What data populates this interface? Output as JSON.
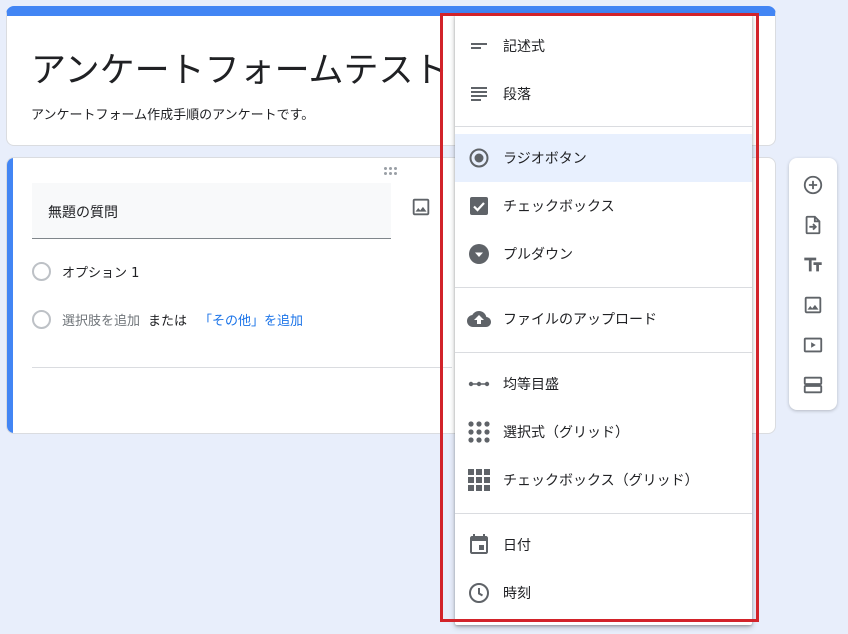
{
  "form": {
    "title": "アンケートフォームテスト",
    "description": "アンケートフォーム作成手順のアンケートです。"
  },
  "question": {
    "title": "無題の質問",
    "option1": "オプション 1",
    "add_option": "選択肢を追加",
    "or_text": "または",
    "add_other": "「その他」を追加"
  },
  "menu": {
    "items": [
      {
        "label": "記述式",
        "icon": "short-text-icon"
      },
      {
        "label": "段落",
        "icon": "paragraph-icon"
      },
      {
        "label": "ラジオボタン",
        "icon": "radio-button-icon"
      },
      {
        "label": "チェックボックス",
        "icon": "checkbox-icon"
      },
      {
        "label": "プルダウン",
        "icon": "dropdown-icon"
      },
      {
        "label": "ファイルのアップロード",
        "icon": "cloud-upload-icon"
      },
      {
        "label": "均等目盛",
        "icon": "linear-scale-icon"
      },
      {
        "label": "選択式（グリッド）",
        "icon": "grid-dots-icon"
      },
      {
        "label": "チェックボックス（グリッド）",
        "icon": "grid-squares-icon"
      },
      {
        "label": "日付",
        "icon": "calendar-icon"
      },
      {
        "label": "時刻",
        "icon": "clock-icon"
      }
    ],
    "selected": "ラジオボタン"
  },
  "toolbar": {
    "buttons": [
      "add-question-icon",
      "import-questions-icon",
      "add-title-icon",
      "add-image-icon",
      "add-video-icon",
      "add-section-icon"
    ]
  },
  "colors": {
    "accent": "#4285f4",
    "highlight": "#d2232a",
    "selected_bg": "#e8f0fe",
    "link": "#1a73e8"
  }
}
